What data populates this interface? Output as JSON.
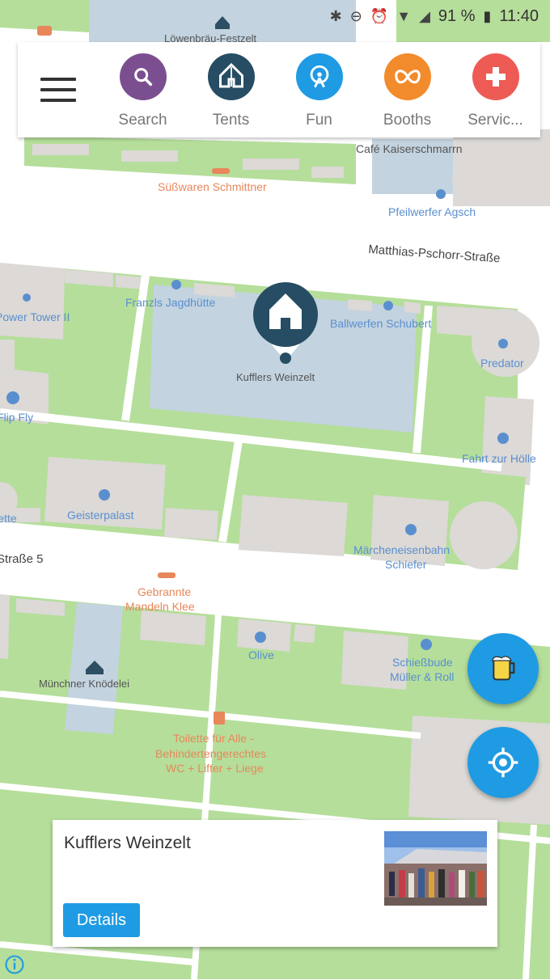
{
  "status_bar": {
    "battery": "91 %",
    "time": "11:40"
  },
  "topbar": {
    "categories": [
      {
        "label": "Search",
        "icon": "search-icon",
        "color": "#7b4f8f"
      },
      {
        "label": "Tents",
        "icon": "tent-icon",
        "color": "#264d63"
      },
      {
        "label": "Fun",
        "icon": "ferris-wheel-icon",
        "color": "#1f9be3"
      },
      {
        "label": "Booths",
        "icon": "pretzel-icon",
        "color": "#f28b2b"
      },
      {
        "label": "Servic...",
        "icon": "plus-icon",
        "color": "#ee5b55"
      }
    ]
  },
  "map": {
    "labels": {
      "loewenbraeu": "Löwenbräu-Festzelt",
      "cafe": "Café Kaiserschmarrn",
      "suesswaren": "Süßwaren Schmittner",
      "pfeilwerfer": "Pfeilwerfer Agsch",
      "street1": "Matthias-Pschorr-Straße",
      "franzls": "Franzls Jagdhütte",
      "tower": "Power Tower II",
      "ballwerfen": "Ballwerfen Schubert",
      "kufflers": "Kufflers Weinzelt",
      "predator": "Predator",
      "flipfly": "Flip Fly",
      "fahrt": "Fahrt zur Hölle",
      "geisterpalast": "Geisterpalast",
      "kette": "Kette",
      "maerchen1": "Märcheneisenbahn",
      "maerchen2": "Schiefer",
      "street2": "Straße 5",
      "gebrannte1": "Gebrannte",
      "gebrannte2": "Mandeln Klee",
      "olive": "Olive",
      "schiessbude1": "Schießbude",
      "schiessbude2": "Müller & Roll",
      "muenchner": "Münchner Knödelei",
      "toilette1": "Toilette für Alle -",
      "toilette2": "Behindertengerechtes",
      "toilette3": "WC + Lifter + Liege"
    }
  },
  "bottom_card": {
    "title": "Kufflers Weinzelt",
    "details_label": "Details"
  },
  "colors": {
    "accent": "#1f9be3",
    "green": "#b5de9a",
    "building": "#dcd9d6",
    "tent_area": "#c3d3df"
  }
}
